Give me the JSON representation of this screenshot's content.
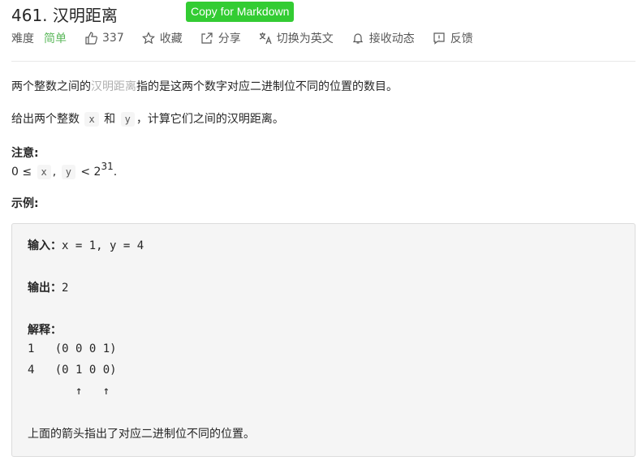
{
  "header": {
    "title": "461. 汉明距离",
    "copy_button": "Copy for Markdown"
  },
  "meta": {
    "difficulty_label": "难度",
    "difficulty_value": "简单",
    "likes": "337",
    "favorite": "收藏",
    "share": "分享",
    "translate": "切换为英文",
    "notify": "接收动态",
    "feedback": "反馈"
  },
  "problem": {
    "p1_before": "两个整数之间的",
    "p1_term": "汉明距离",
    "p1_after": "指的是这两个数字对应二进制位不同的位置的数目。",
    "p2_before": "给出两个整数",
    "var_x": "x",
    "p2_and": "和",
    "var_y": "y",
    "p2_after": "，计算它们之间的汉明距离。",
    "note_title": "注意:",
    "note_prefix": "0 ≤",
    "note_comma": ",",
    "note_lt": "< 2",
    "note_exp": "31",
    "note_end": ".",
    "example_title": "示例:"
  },
  "example": {
    "input_label": "输入：",
    "input_value": "x = 1, y = 4",
    "output_label": "输出：",
    "output_value": "2",
    "explain_label": "解释：",
    "line1": "1   (0 0 0 1)",
    "line2": "4   (0 1 0 0)",
    "arrows": "       ↑   ↑",
    "footer": "上面的箭头指出了对应二进制位不同的位置。"
  },
  "colors": {
    "accent_green": "#33cc33",
    "difficulty_green": "#5cb85c"
  }
}
